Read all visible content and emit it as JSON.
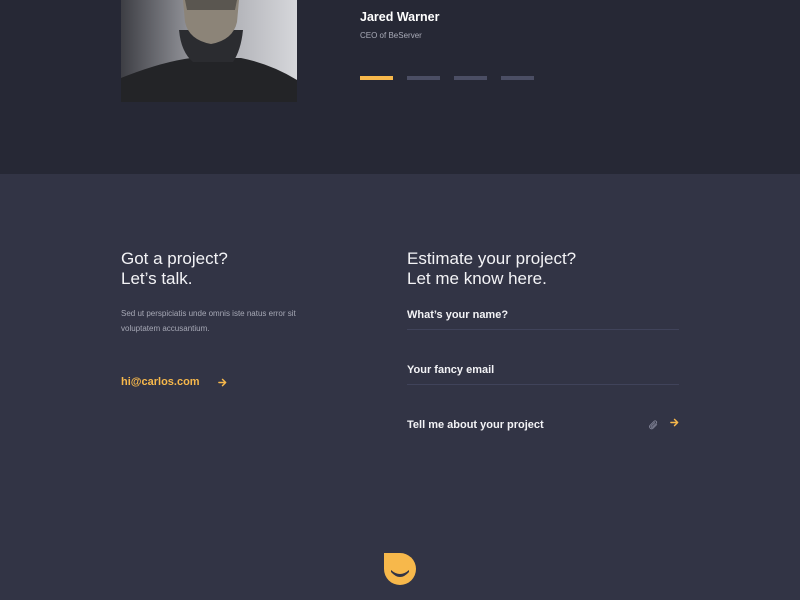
{
  "testimonial": {
    "name": "Jared Warner",
    "role": "CEO of BeServer",
    "slides": [
      {
        "active": true
      },
      {
        "active": false
      },
      {
        "active": false
      },
      {
        "active": false
      }
    ]
  },
  "contact": {
    "heading_line1": "Got a project?",
    "heading_line2": "Let’s talk.",
    "description": "Sed ut perspiciatis unde omnis iste natus error sit voluptatem accusantium.",
    "email": "hi@carlos.com"
  },
  "form": {
    "heading_line1": "Estimate your project?",
    "heading_line2": "Let me know here.",
    "name_placeholder": "What’s your name?",
    "email_placeholder": "Your fancy email",
    "project_placeholder": "Tell me about your project"
  },
  "icons": {
    "email_arrow": "arrow-right-icon",
    "attach": "paperclip-icon",
    "submit": "arrow-right-icon",
    "logo": "logo-icon"
  },
  "colors": {
    "accent": "#f7b84b",
    "testimonial_bg": "#262835",
    "contact_bg": "#323445",
    "inactive_dot": "#4b4e64"
  }
}
